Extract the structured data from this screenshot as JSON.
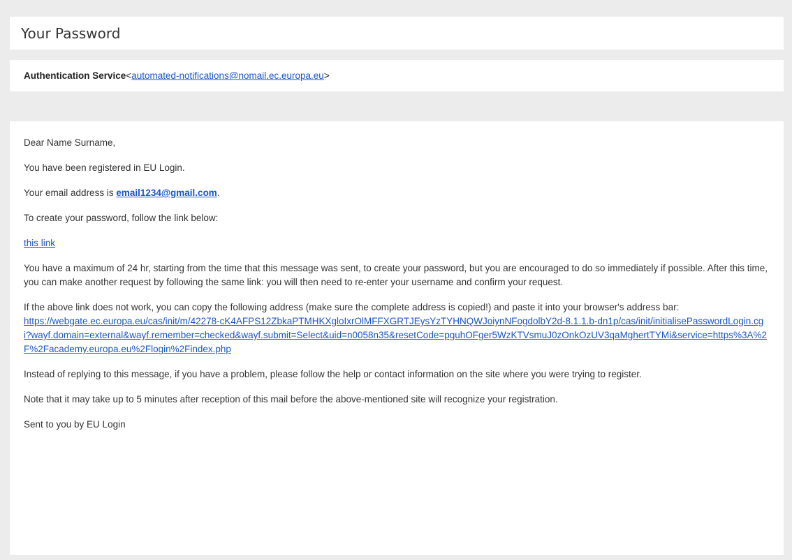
{
  "email": {
    "subject": "Your Password",
    "sender": {
      "name": "Authentication Service",
      "open_bracket": " <",
      "email": "automated-notifications@nomail.ec.europa.eu",
      "close_bracket": ">"
    },
    "body": {
      "greeting": "Dear Name Surname,",
      "registered": "You have been registered in EU Login.",
      "email_line_prefix": "Your email address is ",
      "user_email": "email1234@gmail.com",
      "email_line_suffix": ".",
      "create_instruction": "To create your password, follow the link below:",
      "link_text": "this link",
      "time_limit": "You have a maximum of 24 hr, starting from the time that this message was sent, to create your password, but you are encouraged to do so immediately if possible. After this time, you can make another request by following the same link: you will then need to re-enter your username and confirm your request.",
      "copy_instruction": "If the above link does not work, you can copy the following address (make sure the complete address is copied!) and paste it into your browser's address bar:",
      "full_url": "https://webgate.ec.europa.eu/cas/init/m/42278-cK4AFPS12ZbkaPTMHKXgloIxrOlMFFXGRTJEysYzTYHNQWJoiynNFogdolbY2d-8.1.1.b-dn1p/cas/init/initialisePasswordLogin.cgi?wayf.domain=external&wayf.remember=checked&wayf.submit=Select&uid=n0058n35&resetCode=pguhOFger5WzKTVsmuJ0zOnkOzUV3qaMghertTYMi&service=https%3A%2F%2Facademy.europa.eu%2Flogin%2Findex.php",
      "help_note": "Instead of replying to this message, if you have a problem, please follow the help or contact information on the site where you were trying to register.",
      "delay_note": "Note that it may take up to 5 minutes after reception of this mail before the above-mentioned site will recognize your registration.",
      "signoff": "Sent to you by EU Login"
    }
  },
  "colors": {
    "link": "#1a56c8",
    "background": "#ececec",
    "panel": "#ffffff",
    "text": "#333333"
  }
}
